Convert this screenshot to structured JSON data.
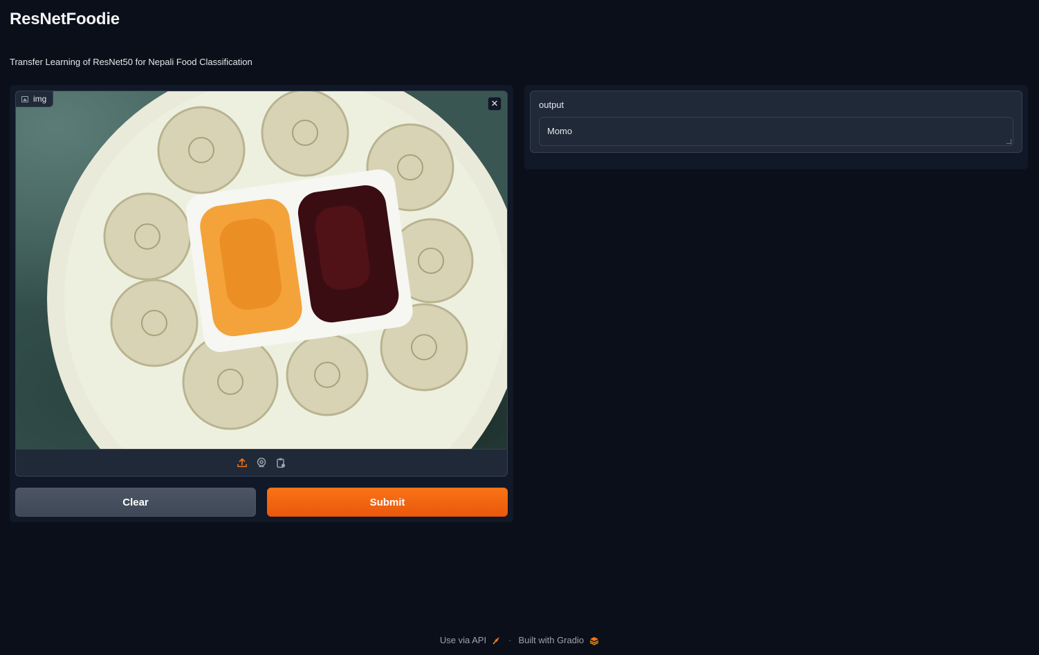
{
  "app": {
    "title": "ResNetFoodie",
    "description": "Transfer Learning of ResNet50 for Nepali Food Classification"
  },
  "input": {
    "label": "img",
    "image_icon": "image-icon",
    "close_icon": "close-icon",
    "toolbar": [
      {
        "icon": "upload-icon",
        "active": true
      },
      {
        "icon": "webcam-icon",
        "active": false
      },
      {
        "icon": "clipboard-icon",
        "active": false
      }
    ]
  },
  "buttons": {
    "clear_label": "Clear",
    "submit_label": "Submit"
  },
  "output": {
    "label": "output",
    "value": "Momo"
  },
  "footer": {
    "api_label": "Use via API",
    "separator": "·",
    "built_label": "Built with Gradio"
  },
  "colors": {
    "background": "#0b0f19",
    "accent": "#f97316",
    "panel": "#111827",
    "block": "#1f2937"
  }
}
